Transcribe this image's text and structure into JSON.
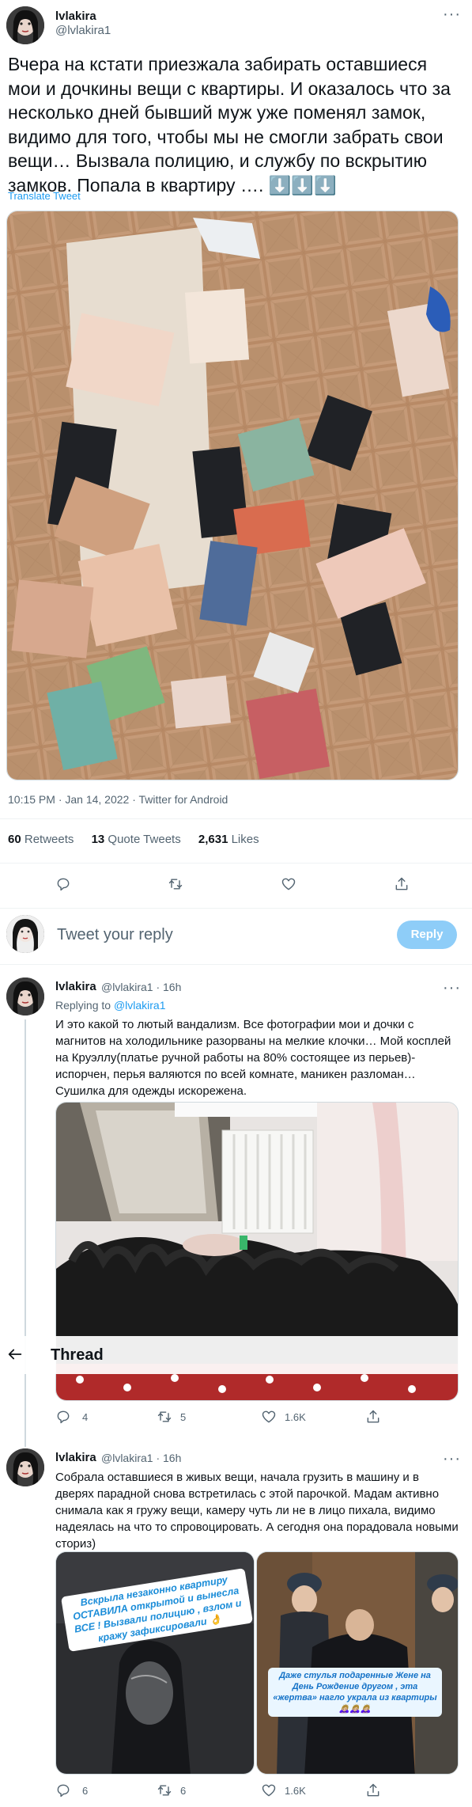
{
  "main_tweet": {
    "display_name": "lvlakira",
    "handle": "@lvlakira1",
    "text": "Вчера на кстати приезжала забирать оставшиеся мои и дочкины вещи с квартиры. И оказалось что за несколько дней бывший муж уже поменял замок, видимо для того, чтобы мы не смогли забрать свои вещи… Вызвала полицию, и службу по вскрытию замков. Попала в квартиру …. ⬇️⬇️⬇️",
    "translate_label": "Translate Tweet",
    "timestamp": "10:15 PM · Jan 14, 2022 · Twitter for Android",
    "retweets_count": "60",
    "retweets_label": "Retweets",
    "quote_count": "13",
    "quote_label": "Quote Tweets",
    "likes_count": "2,631",
    "likes_label": "Likes"
  },
  "composer": {
    "placeholder": "Tweet your reply",
    "reply_button": "Reply"
  },
  "thread_header": {
    "title": "Thread"
  },
  "replies": [
    {
      "display_name": "lvlakira",
      "handle_time": "@lvlakira1 · 16h",
      "replying_prefix": "Replying to",
      "replying_to": "@lvlakira1",
      "text": "И это какой то лютый вандализм. Все фотографии мои и дочки с магнитов на холодильнике разорваны на мелкие клочки… Мой косплей на Круэллу(платье ручной работы на 80% состоящее из перьев)-испорчен, перья валяются по всей комнате, маникен разломан…Сушилка для одежды искорежена.",
      "reply_count": "4",
      "retweet_count": "5",
      "like_count": "1.6K"
    },
    {
      "display_name": "lvlakira",
      "handle_time": "@lvlakira1 · 16h",
      "text": "Собрала оставшиеся в живых вещи, начала грузить в машину и в дверях парадной снова встретилась с этой парочкой. Мадам активно снимала как я гружу вещи, камеру чуть ли не в лицо пихала, видимо надеялась на что то спровоцировать. А сегодня она порадовала новыми сториз)",
      "sticker_left": "Вскрыла незаконно квартиру ОСТАВИЛА открытой и вынесла ВСЕ ! Вызвали полицию , взлом и кражу зафиксировали 👌",
      "sticker_right": "Даже стулья подаренные Жене на День Рождение другом , эта «жертва» нагло украла из квартиры 🙇🏼‍♀️🙇🏼‍♀️🙇🏼‍♀️",
      "reply_count": "6",
      "retweet_count": "6",
      "like_count": "1.6K"
    }
  ],
  "icons": {
    "reply": "reply-icon",
    "retweet": "retweet-icon",
    "like": "heart-icon",
    "share": "share-icon",
    "more": "more-icon",
    "back": "back-arrow-icon"
  },
  "colors": {
    "accent": "#1d9bf0",
    "text": "#0f1419",
    "muted": "#536471",
    "reply_button_disabled": "#8ecdf8"
  }
}
